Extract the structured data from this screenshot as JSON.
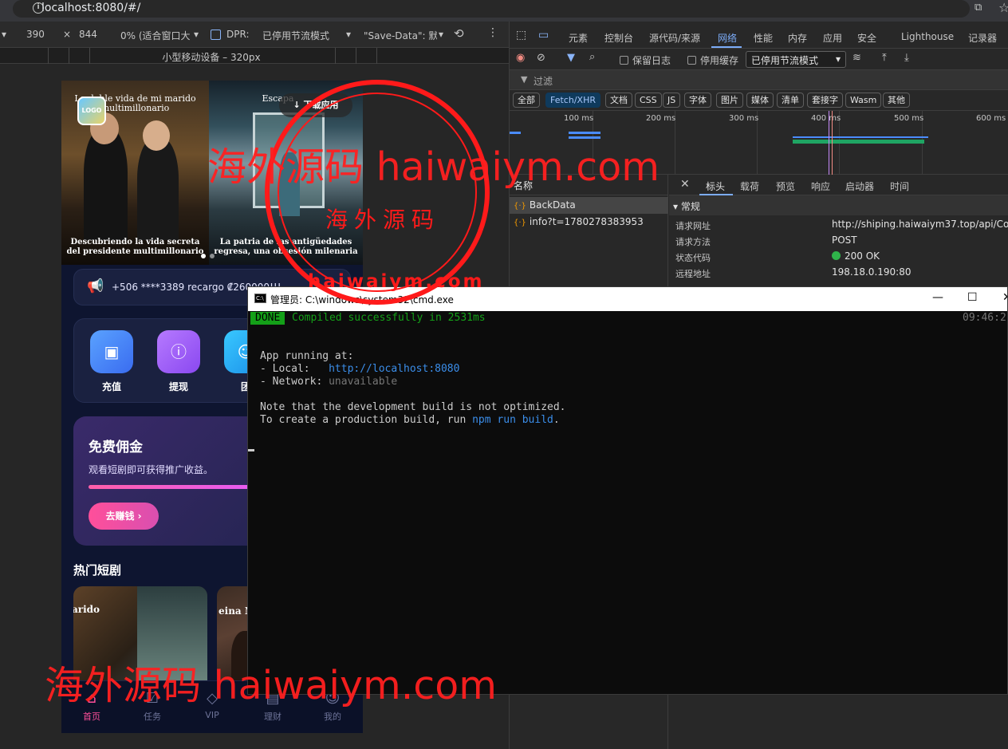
{
  "browser": {
    "url": "localhost:8080/#/"
  },
  "device_toolbar": {
    "width": "390",
    "height": "844",
    "zoom": "0% (适合窗口大",
    "dpr_label": "DPR:",
    "throttle": "已停用节流模式",
    "save_data": "\"Save-Data\": 默",
    "device_label": "小型移动设备 – 320px"
  },
  "app": {
    "slides": [
      {
        "title": "La doble vida de mi marido multimillonario",
        "caption": "Descubriendo la vida secreta del presidente multimillonario"
      },
      {
        "title": "Escapa",
        "caption": "La patria de las antigüedades regresa, una obsesión milenaria"
      }
    ],
    "download_label": "↓ 下载应用",
    "notice_text": "+506 ****3389 recargo ₡260000!!!",
    "quick_actions": [
      {
        "label": "充值",
        "icon": "wallet-icon",
        "color": "#4a8cff"
      },
      {
        "label": "提现",
        "icon": "info-icon",
        "color": "#9b5cff"
      },
      {
        "label": "团",
        "icon": "team-icon",
        "color": "#27b5ff"
      }
    ],
    "promo": {
      "title": "免费佣金",
      "desc": "观看短剧即可获得推广收益。",
      "button": "去赚钱 ›"
    },
    "hot_title": "热门短剧",
    "dramas": [
      {
        "title": "arido"
      },
      {
        "title": "eina N"
      }
    ],
    "tabs": [
      {
        "label": "首页",
        "icon": "home-icon",
        "active": true
      },
      {
        "label": "任务",
        "icon": "task-icon",
        "active": false
      },
      {
        "label": "VIP",
        "icon": "diamond-icon",
        "active": false
      },
      {
        "label": "理财",
        "icon": "finance-icon",
        "active": false
      },
      {
        "label": "我的",
        "icon": "user-icon",
        "active": false
      }
    ]
  },
  "devtools": {
    "tabs": [
      "元素",
      "控制台",
      "源代码/来源",
      "网络",
      "性能",
      "内存",
      "应用",
      "安全",
      "Lighthouse",
      "记录器"
    ],
    "active_tab": "网络",
    "preserve_log": "保留日志",
    "disable_cache": "停用缓存",
    "throttle": "已停用节流模式",
    "filter_placeholder": "过滤",
    "type_filters": [
      "全部",
      "Fetch/XHR",
      "文档",
      "CSS",
      "JS",
      "字体",
      "图片",
      "媒体",
      "清单",
      "套接字",
      "Wasm",
      "其他"
    ],
    "active_type": "Fetch/XHR",
    "timeline_labels": [
      "100 ms",
      "200 ms",
      "300 ms",
      "400 ms",
      "500 ms",
      "600 ms"
    ],
    "name_header": "名称",
    "requests": [
      {
        "name": "BackData",
        "selected": true
      },
      {
        "name": "info?t=1780278383953",
        "selected": false
      }
    ],
    "detail_tabs": [
      "标头",
      "载荷",
      "预览",
      "响应",
      "启动器",
      "时间"
    ],
    "active_detail_tab": "标头",
    "general_title": "▾ 常规",
    "general": [
      {
        "key": "请求网址",
        "value": "http://shiping.haiwaiym37.top/api/Con"
      },
      {
        "key": "请求方法",
        "value": "POST"
      },
      {
        "key": "状态代码",
        "value": "200 OK"
      },
      {
        "key": "远程地址",
        "value": "198.18.0.190:80"
      }
    ]
  },
  "cmd": {
    "title": "管理员: C:\\windows\\system32\\cmd.exe",
    "done_badge": "DONE",
    "done_msg": "Compiled successfully in 2531ms",
    "time": "09:46:2",
    "running": "App running at:",
    "local_label": "- Local:   ",
    "local_url": "http://localhost:8080",
    "network_label": "- Network: ",
    "network_value": "unavailable",
    "note": "Note that the development build is not optimized.",
    "build_prefix": "To create a production build, run ",
    "build_cmd": "npm run build",
    "build_suffix": "."
  },
  "watermark": {
    "text1": "海外源码 haiwaiym.com",
    "text2": "海外源码 haiwaiym.com",
    "seal_cn": "海外源码",
    "seal_url": "haiwaiym.com"
  }
}
